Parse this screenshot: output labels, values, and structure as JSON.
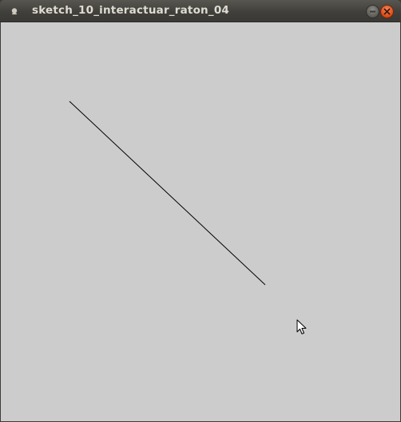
{
  "window": {
    "title": "sketch_10_interactuar_raton_04"
  },
  "titlebar": {
    "app_icon": "app-icon",
    "minimize_icon": "minimize-icon",
    "close_icon": "close-icon"
  },
  "canvas": {
    "background_color": "#cccccc",
    "stroke_color": "#000000"
  },
  "cursor": {
    "icon": "mouse-pointer-icon"
  }
}
